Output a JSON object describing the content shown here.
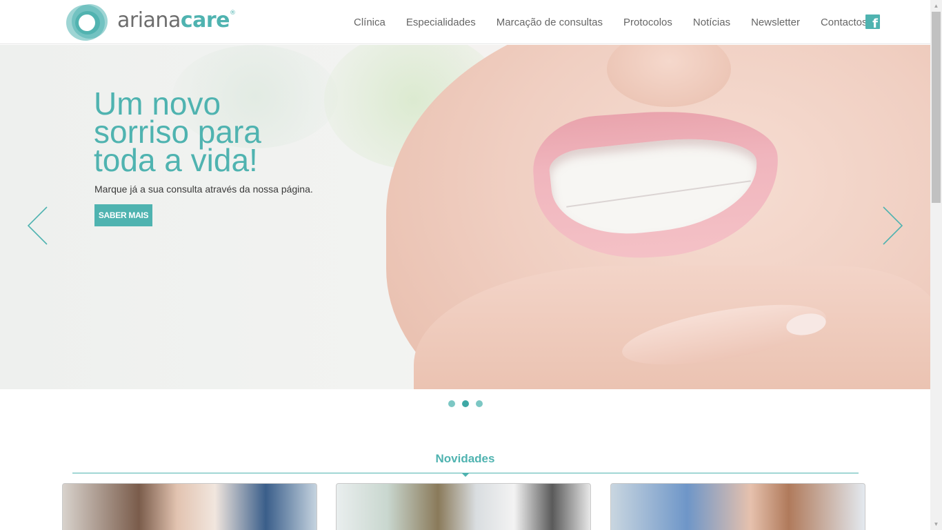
{
  "brand": {
    "name_part1": "ariana",
    "name_part2": "care",
    "registered": "®",
    "accent_color": "#4fb3b0"
  },
  "nav": {
    "items": [
      {
        "label": "Clínica"
      },
      {
        "label": "Especialidades"
      },
      {
        "label": "Marcação de consultas"
      },
      {
        "label": "Protocolos"
      },
      {
        "label": "Notícias"
      },
      {
        "label": "Newsletter"
      },
      {
        "label": "Contactos"
      }
    ],
    "social_icon": "facebook-icon"
  },
  "hero": {
    "title_line1": "Um novo",
    "title_line2": "sorriso para",
    "title_line3": "toda a vida!",
    "subtitle": "Marque já a sua consulta através da nossa página.",
    "button_label": "SABER MAIS",
    "slides_total": 3,
    "active_slide": 2
  },
  "news": {
    "heading": "Novidades",
    "cards": 3
  }
}
